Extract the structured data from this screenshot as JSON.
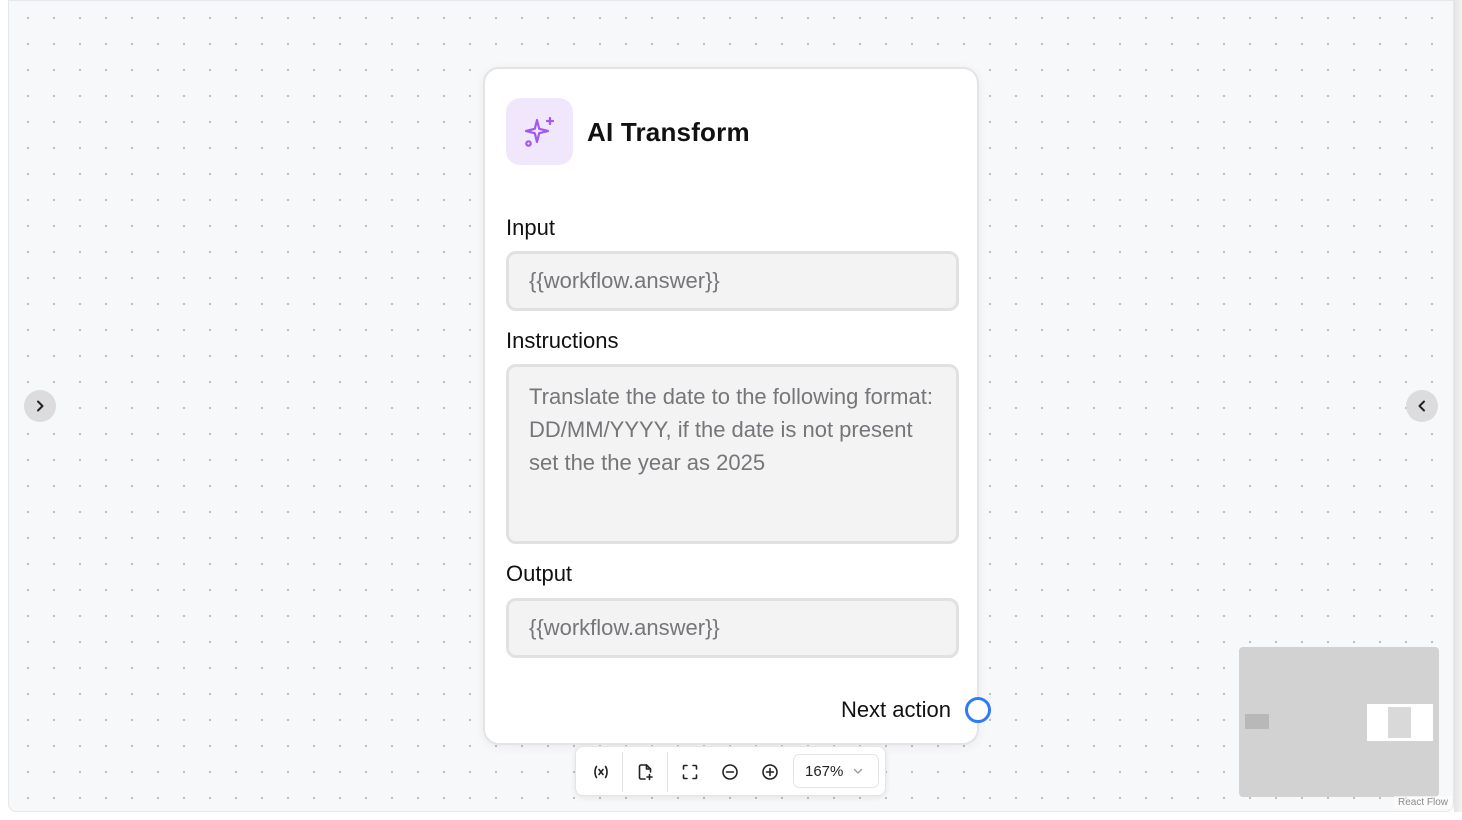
{
  "node": {
    "title": "AI Transform",
    "icon": "sparkles-icon",
    "input": {
      "label": "Input",
      "value": "{{workflow.answer}}"
    },
    "instructions": {
      "label": "Instructions",
      "value": "Translate the date to the following format: DD/MM/YYYY, if the date is not present set the the year as 2025"
    },
    "output": {
      "label": "Output",
      "value": "{{workflow.answer}}"
    },
    "next_action_label": "Next action"
  },
  "toolbar": {
    "buttons": [
      "variable-icon",
      "add-file-icon",
      "fit-view-icon",
      "zoom-out-icon",
      "zoom-in-icon"
    ],
    "zoom_level": "167%"
  },
  "attribution": "React Flow",
  "colors": {
    "accent_purple": "#a259f0",
    "icon_bg": "#f1e7fd",
    "handle_blue": "#2f7bf5",
    "canvas_bg": "#f7f8fa"
  }
}
